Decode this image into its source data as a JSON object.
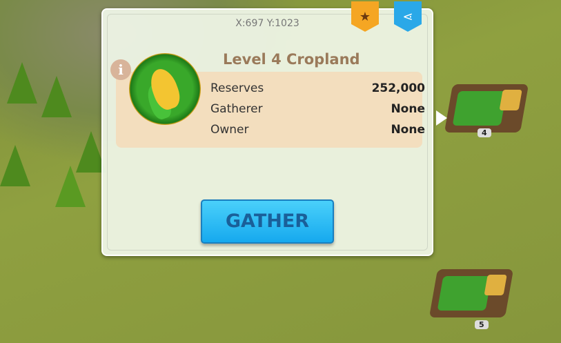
{
  "coords": "X:697 Y:1023",
  "title": "Level 4 Cropland",
  "stats": [
    {
      "label": "Reserves",
      "value": "252,000"
    },
    {
      "label": "Gatherer",
      "value": "None"
    },
    {
      "label": "Owner",
      "value": "None"
    }
  ],
  "gather_label": "GATHER",
  "map_tiles": [
    {
      "level": "4"
    },
    {
      "level": "5"
    }
  ],
  "icons": {
    "bookmark": "star-icon",
    "share": "share-icon",
    "info": "info-icon",
    "resource": "corn-icon"
  },
  "colors": {
    "gather_button": "#2bbcf5",
    "bookmark": "#f5a623",
    "share": "#2aa8e8",
    "title": "#9a7a5a"
  }
}
